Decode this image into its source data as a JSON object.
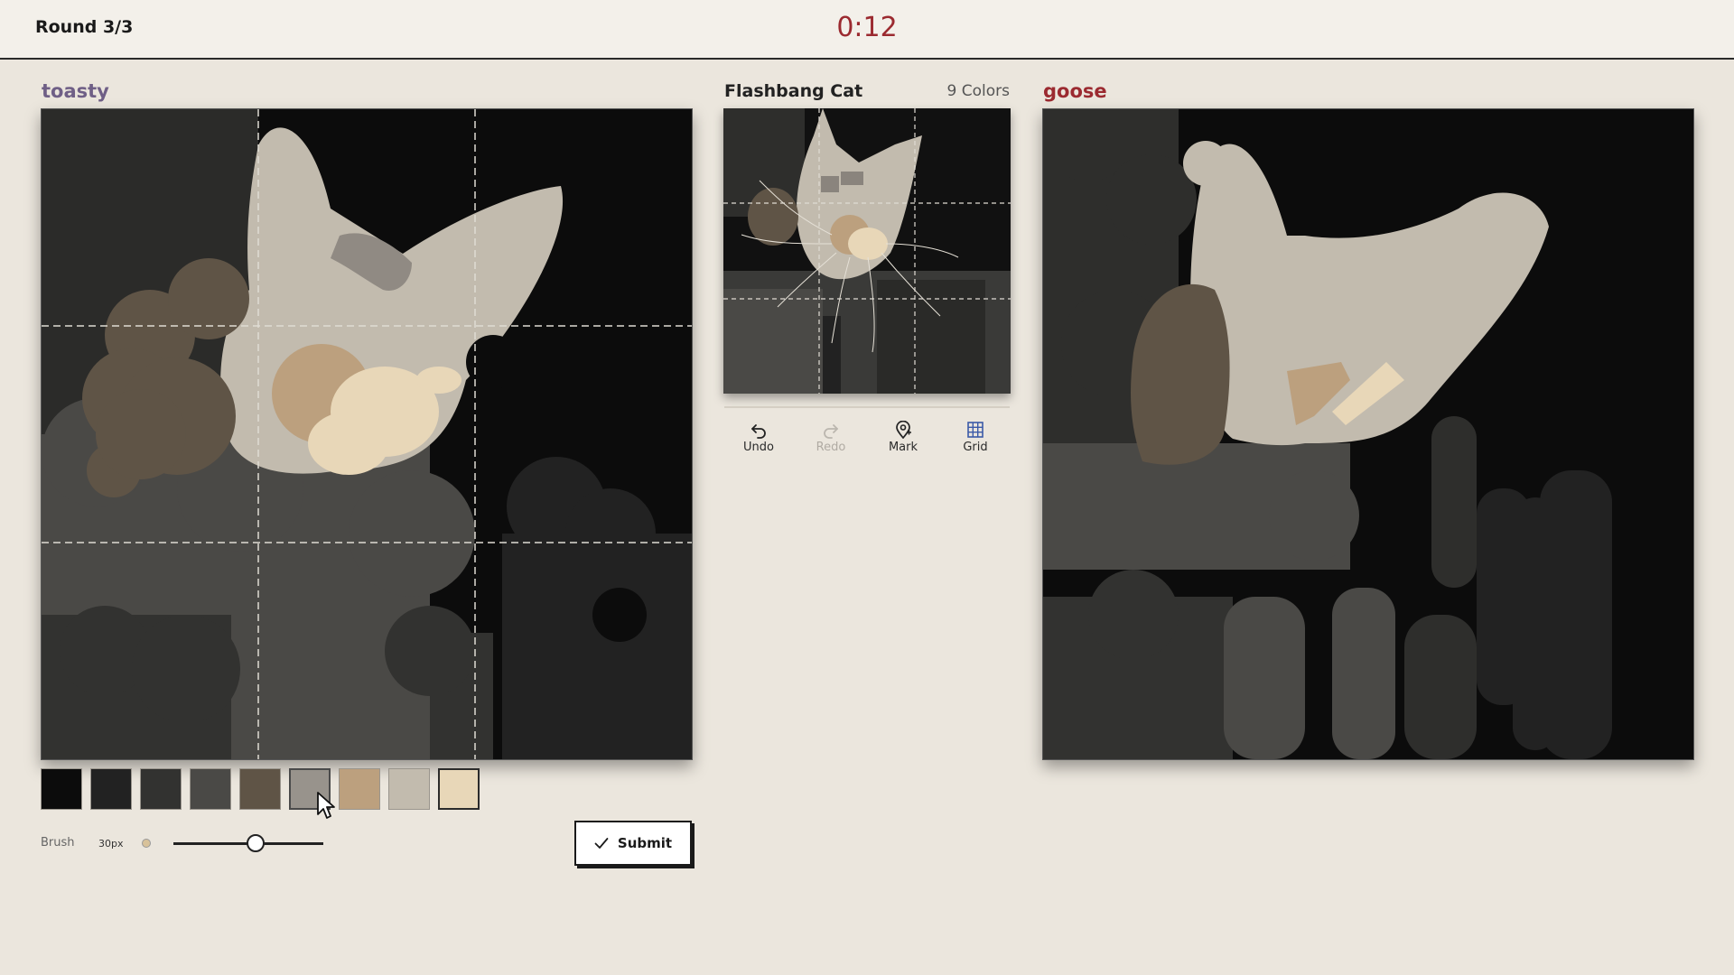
{
  "header": {
    "round": "Round 3/3",
    "timer": "0:12"
  },
  "players": {
    "left": "toasty",
    "right": "goose"
  },
  "reference": {
    "title": "Flashbang Cat",
    "colors": "9 Colors"
  },
  "tools": {
    "undo": "Undo",
    "redo": "Redo",
    "mark": "Mark",
    "grid": "Grid"
  },
  "palette": {
    "colors": [
      "#0c0c0c",
      "#222222",
      "#323230",
      "#4a4946",
      "#5f5446",
      "#98938c",
      "#bca07e",
      "#c2bbae",
      "#e8d7b8"
    ],
    "selected_index": 5
  },
  "brush": {
    "label": "Brush",
    "size": "30px",
    "level": 0.55
  },
  "submit": {
    "label": "Submit"
  },
  "icons": [
    "undo-icon",
    "redo-icon",
    "map-pin-icon",
    "grid-icon",
    "check-icon",
    "cursor-icon"
  ]
}
